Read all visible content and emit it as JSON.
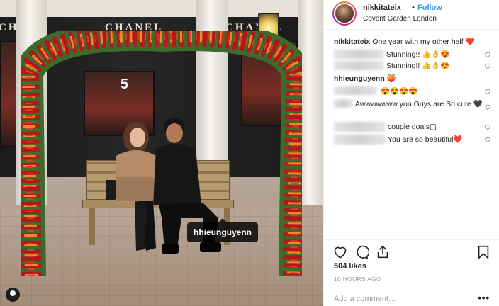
{
  "photo": {
    "shop_signs": [
      "CHANEL",
      "CHANEL",
      "CHAN"
    ],
    "window_number": "5",
    "tagged_user": "hhieunguyenn"
  },
  "header": {
    "username": "nikkitateix",
    "separator": "•",
    "follow_label": "Follow",
    "location": "Covent Garden London"
  },
  "caption": {
    "username": "nikkitateix",
    "text": "One year with my other half ❤️"
  },
  "comments": [
    {
      "username": "",
      "text": "Stunning!! 👍👌😍"
    },
    {
      "username": "",
      "text": "Stunning!! 👍👌😍"
    },
    {
      "username": "hhieunguyenn",
      "text": "🍑"
    },
    {
      "username": "",
      "text": "😍😍😍😍"
    },
    {
      "username": "",
      "text": "Awwwwwww you Guys are So cute 🖤"
    },
    {
      "username": "",
      "text": "couple goals▢"
    },
    {
      "username": "",
      "text": "You are so beautiful❤️"
    }
  ],
  "actions": {
    "like_icon": "heart-icon",
    "comment_icon": "comment-icon",
    "share_icon": "share-icon",
    "save_icon": "bookmark-icon"
  },
  "likes": "504 likes",
  "timestamp": "10 HOURS AGO",
  "add_comment": {
    "placeholder": "Add a comment…",
    "more_label": "•••"
  },
  "colors": {
    "follow_blue": "#3897f0",
    "text": "#262626",
    "muted": "#999999"
  }
}
